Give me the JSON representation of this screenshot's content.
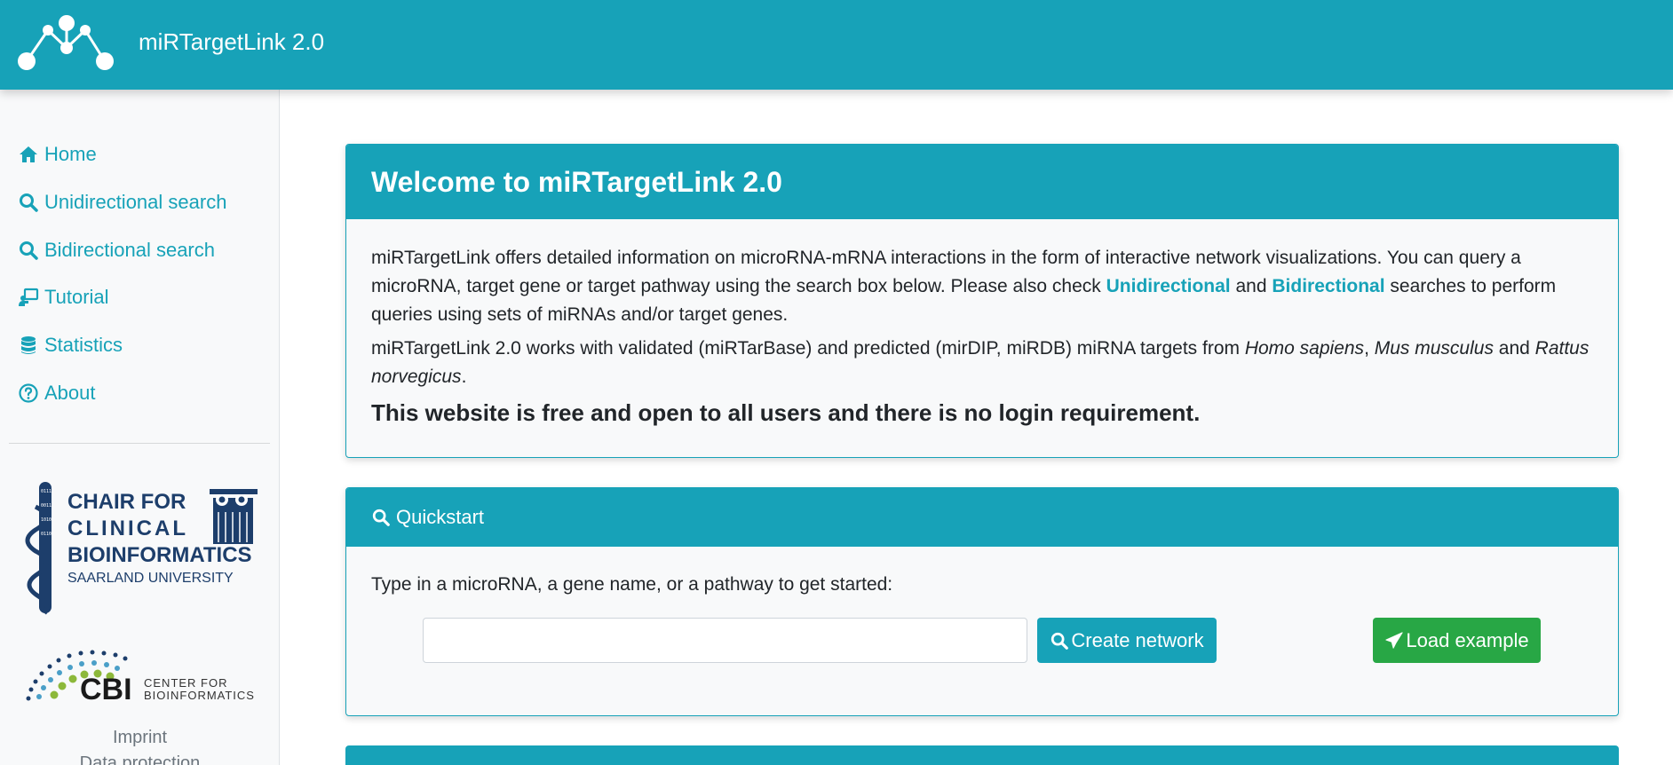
{
  "header": {
    "brand": "miRTargetLink 2.0",
    "logo_icon": "network-logo-icon"
  },
  "sidebar": {
    "items": [
      {
        "label": "Home",
        "icon": "home-icon"
      },
      {
        "label": "Unidirectional search",
        "icon": "search-icon"
      },
      {
        "label": "Bidirectional search",
        "icon": "search-icon"
      },
      {
        "label": "Tutorial",
        "icon": "tutorial-icon"
      },
      {
        "label": "Statistics",
        "icon": "database-icon"
      },
      {
        "label": "About",
        "icon": "question-circle-icon"
      }
    ],
    "logo_chair": [
      "CHAIR FOR",
      "CLINICAL",
      "BIOINFORMATICS",
      "SAARLAND UNIVERSITY"
    ],
    "logo_cbi": {
      "abbr": "CBI",
      "line1": "CENTER FOR",
      "line2": "BIOINFORMATICS"
    },
    "footer": {
      "imprint": "Imprint",
      "data_protection": "Data protection"
    }
  },
  "welcome": {
    "title": "Welcome to miRTargetLink 2.0",
    "p1_a": "miRTargetLink offers detailed information on microRNA-mRNA interactions in the form of interactive network visualizations. You can query a microRNA, target gene or target pathway using the search box below. Please also check ",
    "p1_link1": "Unidirectional",
    "p1_b": " and ",
    "p1_link2": "Bidirectional",
    "p1_c": " searches to perform queries using sets of miRNAs and/or target genes.",
    "p2_a": "miRTargetLink 2.0 works with validated (miRTarBase) and predicted (mirDIP, miRDB) miRNA targets from ",
    "p2_sp1": "Homo sapiens",
    "p2_comma": ", ",
    "p2_sp2": "Mus musculus",
    "p2_and": " and ",
    "p2_sp3": "Rattus norvegicus",
    "p2_end": ".",
    "free_text": "This website is free and open to all users and there is no login requirement."
  },
  "quickstart": {
    "title": "Quickstart",
    "prompt": "Type in a microRNA, a gene name, or a pathway to get started:",
    "input_value": "",
    "input_placeholder": "",
    "create_label": "Create network",
    "load_label": "Load example"
  },
  "colors": {
    "accent": "#17a2b8",
    "success": "#28a745",
    "sidebar_bg": "#f8f9fa",
    "chair_navy": "#1d3e6b",
    "cbi_green": "#8cb83a"
  }
}
